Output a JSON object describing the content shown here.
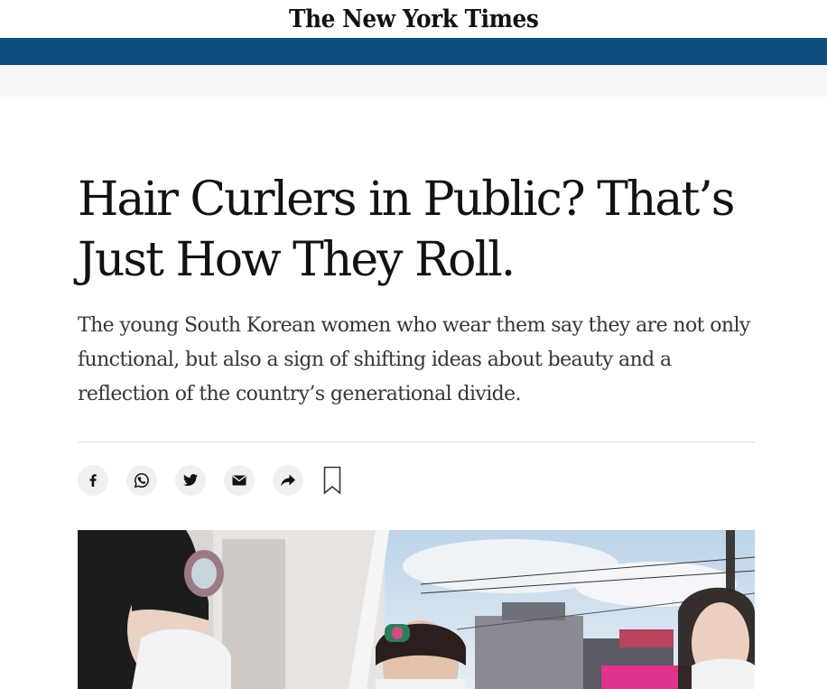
{
  "masthead": {
    "logo_text": "The New York Times"
  },
  "article": {
    "headline": "Hair Curlers in Public? That’s Just How They Roll.",
    "summary": "The young South Korean women who wear them say they are not only functional, but also a sign of shifting ideas about beauty and a reflection of the country’s generational divide."
  },
  "share": {
    "buttons": [
      {
        "icon": "facebook-icon"
      },
      {
        "icon": "whatsapp-icon"
      },
      {
        "icon": "twitter-icon"
      },
      {
        "icon": "email-icon"
      },
      {
        "icon": "share-arrow-icon"
      }
    ],
    "bookmark_icon": "bookmark-icon"
  },
  "colors": {
    "nav_bar": "#0e4e82",
    "sub_bar": "#f7f7f7",
    "text": "#121212",
    "summary_text": "#363636",
    "icon_bg": "#f0f0f0"
  }
}
